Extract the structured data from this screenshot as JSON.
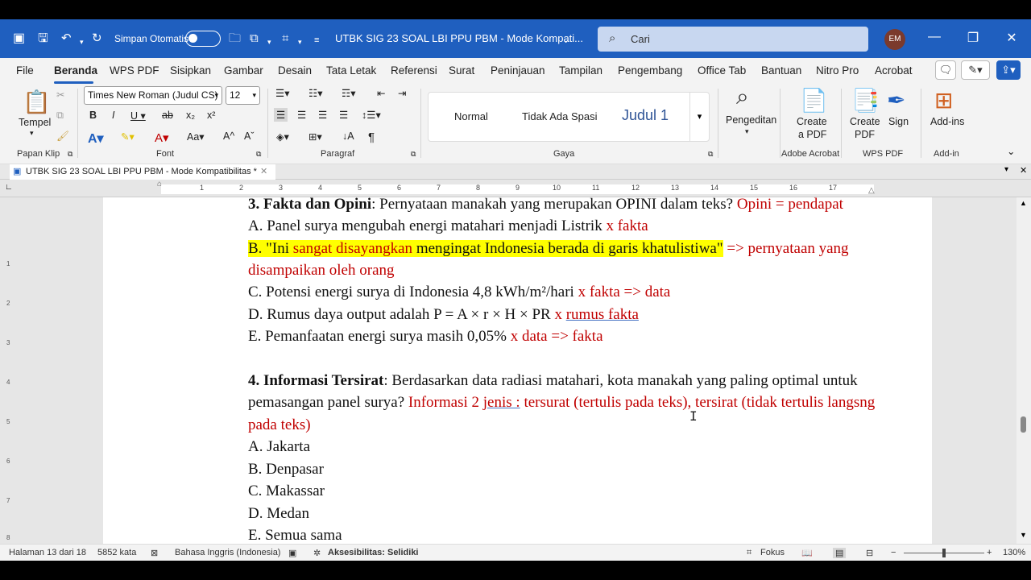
{
  "titlebar": {
    "autosave_label": "Simpan Otomatis",
    "doc_title": "UTBK SIG 23 SOAL LBI PPU PBM  -  Mode Kompati...",
    "search_placeholder": "Cari",
    "avatar_initials": "EM",
    "accent_color": "#1f5fbf"
  },
  "menu": {
    "tabs": [
      "File",
      "Beranda",
      "WPS PDF",
      "Sisipkan",
      "Gambar",
      "Desain",
      "Tata Letak",
      "Referensi",
      "Surat",
      "Peninjauan",
      "Tampilan",
      "Pengembang",
      "Office Tab",
      "Bantuan",
      "Nitro Pro",
      "Acrobat"
    ],
    "active_tab": "Beranda"
  },
  "ribbon": {
    "paste_label": "Tempel",
    "font_name": "Times New Roman (Judul CS)",
    "font_size": "12",
    "styles": [
      "Normal",
      "Tidak Ada Spasi",
      "Judul 1"
    ],
    "editing_label": "Pengeditan",
    "create_a_pdf": [
      "Create",
      "a PDF"
    ],
    "create_pdf": [
      "Create",
      "PDF"
    ],
    "sign_label": "Sign",
    "addins_label": "Add-ins",
    "groups": [
      "Papan Klip",
      "Font",
      "Paragraf",
      "Gaya",
      "Adobe Acrobat",
      "WPS PDF",
      "Add-in"
    ]
  },
  "doctab": {
    "label": "UTBK SIG 23 SOAL LBI PPU PBM  -  Mode Kompatibilitas *"
  },
  "ruler": {
    "numbers": [
      "1",
      "2",
      "3",
      "4",
      "5",
      "6",
      "7",
      "8",
      "9",
      "10",
      "11",
      "12",
      "13",
      "14",
      "15",
      "16",
      "17"
    ],
    "vnumbers": [
      "1",
      "2",
      "3",
      "4",
      "5",
      "6",
      "7",
      "8"
    ]
  },
  "document": {
    "q3_num": "3. Fakta dan Opini",
    "q3_text": ": Pernyataan manakah yang merupakan OPINI dalam teks? ",
    "q3_note": "Opini = pendapat",
    "a3": "A. Panel surya mengubah energi matahari menjadi Listrik ",
    "a3_note": "x fakta",
    "b3_pre": "B. \"Ini ",
    "b3_red": "sangat disayangkan",
    "b3_post": " mengingat Indonesia berada di garis khatulistiwa\"",
    "b3_note": " => pernyataan yang",
    "b3_note2": "disampaikan oleh orang",
    "c3": "C. Potensi energi surya di Indonesia 4,8 kWh/m²/hari ",
    "c3_note": "x fakta => data",
    "d3": "D. Rumus daya output adalah P = A × r × H × PR ",
    "d3_note_x": "x ",
    "d3_note_u": "rumus  fakta",
    "e3": "E. Pemanfaatan energi surya masih 0,05% ",
    "e3_note": "x data => fakta",
    "q4_num": "4. Informasi Tersirat",
    "q4_text": ": Berdasarkan data radiasi matahari, kota manakah yang paling optimal untuk",
    "q4_text2": "pemasangan panel surya? ",
    "q4_note_a": "Informasi 2 ",
    "q4_note_u": "jenis :",
    "q4_note_b": " tersurat (tertulis pada teks), tersirat (tidak tertulis langsng",
    "q4_note2": "pada teks)",
    "options4": [
      "A. Jakarta",
      "B. Denpasar",
      "C. Makassar",
      "D. Medan",
      "E. Semua sama"
    ]
  },
  "statusbar": {
    "page": "Halaman 13 dari 18",
    "words": "5852 kata",
    "language": "Bahasa Inggris (Indonesia)",
    "accessibility": "Aksesibilitas: Selidiki",
    "focus": "Fokus",
    "zoom": "130%"
  }
}
